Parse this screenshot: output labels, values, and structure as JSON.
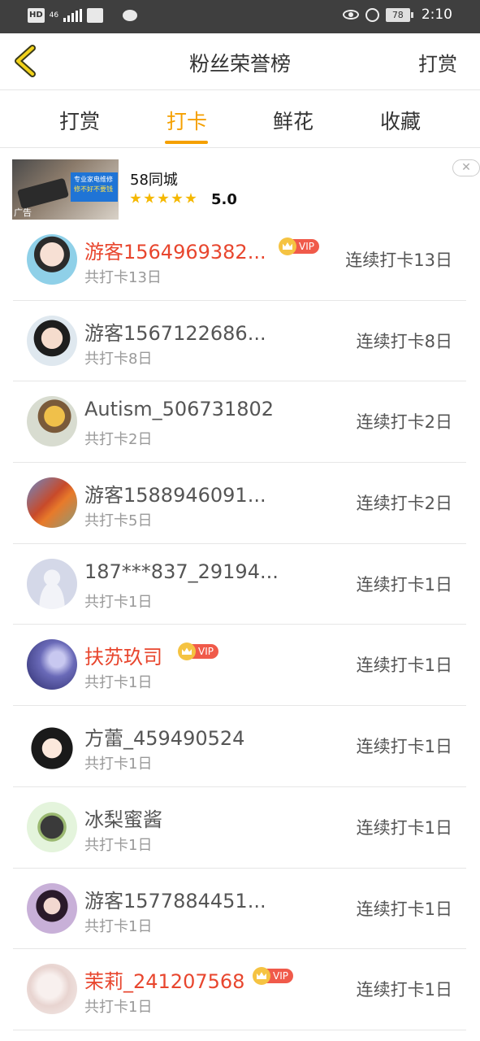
{
  "status_bar": {
    "hd": "HD",
    "net": "46",
    "battery": "78",
    "time": "2:10"
  },
  "nav": {
    "title": "粉丝荣誉榜",
    "action": "打赏",
    "back_icon": "chevron-left-icon"
  },
  "tabs": [
    {
      "label": "打赏",
      "active": false
    },
    {
      "label": "打卡",
      "active": true
    },
    {
      "label": "鲜花",
      "active": false
    },
    {
      "label": "收藏",
      "active": false
    }
  ],
  "accent_color": "#f5a000",
  "ad": {
    "name": "58同城",
    "rating": "5.0",
    "stars": 5,
    "tag": "广告",
    "sign_line1": "专业家电维修",
    "sign_line2": "修不好不要钱"
  },
  "users": [
    {
      "name": "游客1564969382...",
      "vip": true,
      "vip_label": "VIP",
      "total": "共打卡13日",
      "streak": "连续打卡13日"
    },
    {
      "name": "游客1567122686...",
      "vip": false,
      "total": "共打卡8日",
      "streak": "连续打卡8日"
    },
    {
      "name": "Autism_506731802",
      "vip": false,
      "total": "共打卡2日",
      "streak": "连续打卡2日"
    },
    {
      "name": "游客1588946091...",
      "vip": false,
      "total": "共打卡5日",
      "streak": "连续打卡2日"
    },
    {
      "name": "187***837_29194...",
      "vip": false,
      "total": "共打卡1日",
      "streak": "连续打卡1日"
    },
    {
      "name": "扶苏玖司",
      "vip": true,
      "vip_label": "VIP",
      "total": "共打卡1日",
      "streak": "连续打卡1日"
    },
    {
      "name": "方蕾_459490524",
      "vip": false,
      "total": "共打卡1日",
      "streak": "连续打卡1日"
    },
    {
      "name": "冰梨蜜酱",
      "vip": false,
      "total": "共打卡1日",
      "streak": "连续打卡1日"
    },
    {
      "name": "游客1577884451...",
      "vip": false,
      "total": "共打卡1日",
      "streak": "连续打卡1日"
    },
    {
      "name": "茉莉_241207568",
      "vip": true,
      "vip_label": "VIP",
      "total": "共打卡1日",
      "streak": "连续打卡1日"
    }
  ]
}
